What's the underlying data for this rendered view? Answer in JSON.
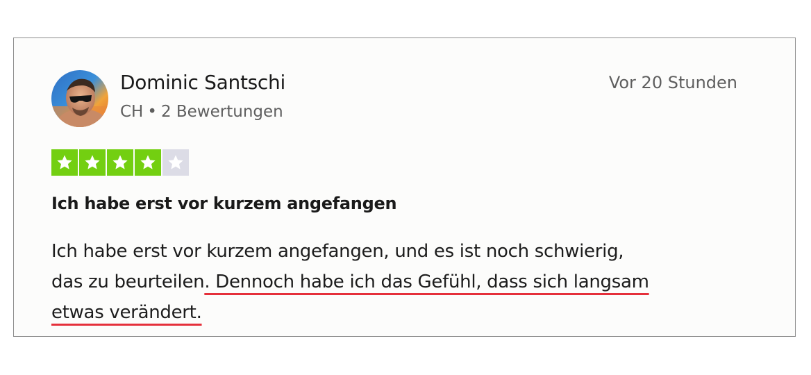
{
  "reviewer": {
    "name": "Dominic Santschi",
    "country": "CH",
    "separator": "•",
    "review_count": "2 Bewertungen",
    "avatar_icon": "user-avatar-photo"
  },
  "review": {
    "date": "Vor 20 Stunden",
    "rating": 4,
    "rating_max": 5,
    "title": "Ich habe erst vor kurzem angefangen",
    "body_line1": "Ich habe erst vor kurzem angefangen, und es ist noch schwierig,",
    "body_line2_plain": "das zu beurteilen",
    "body_line2_highlight": ". Dennoch habe ich das Gefühl, dass sich langsam",
    "body_line3_highlight": "etwas verändert."
  },
  "colors": {
    "star_filled": "#73cf11",
    "star_empty": "#dcdce6",
    "highlight_underline": "#e5303b",
    "card_border": "#8d8d8d"
  },
  "icons": {
    "star": "star-icon"
  }
}
